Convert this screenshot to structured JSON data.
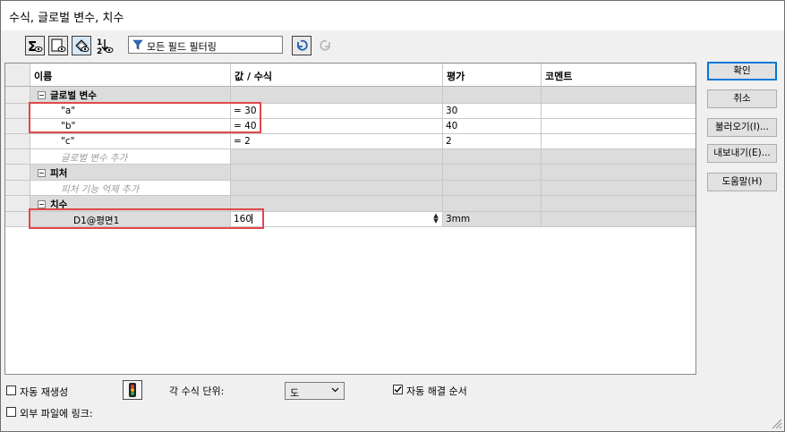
{
  "window": {
    "title": "수식, 글로벌 변수, 치수"
  },
  "toolbar": {
    "filter_text": "모든 필드 필터링",
    "icons": [
      "sigma-eye-icon",
      "display-pane-icon",
      "pressed-settings-icon",
      "sort-12-icon",
      "filter-funnel-icon",
      "undo-icon",
      "redo-icon"
    ]
  },
  "grid": {
    "columns": [
      "이름",
      "값 / 수식",
      "평가",
      "코멘트"
    ],
    "groups": {
      "globals": {
        "label": "글로벌 변수",
        "rows": [
          {
            "name": "\"a\"",
            "value": "= 30",
            "eval": "30",
            "comment": ""
          },
          {
            "name": "\"b\"",
            "value": "= 40",
            "eval": "40",
            "comment": ""
          },
          {
            "name": "\"c\"",
            "value": "= 2",
            "eval": "2",
            "comment": ""
          }
        ],
        "add_placeholder": "글로벌 변수 추가"
      },
      "features": {
        "label": "피처",
        "add_placeholder": "피처 기능 억제 추가"
      },
      "dimensions": {
        "label": "치수",
        "rows": [
          {
            "name": "D1@평면1",
            "value": "160",
            "eval": "3mm",
            "comment": ""
          }
        ]
      }
    }
  },
  "buttons": {
    "ok": "확인",
    "cancel": "취소",
    "import": "불러오기(I)...",
    "export": "내보내기(E)...",
    "help": "도움말(H)"
  },
  "footer": {
    "auto_rebuild_label": "자동 재생성",
    "auto_rebuild_checked": false,
    "link_external_label": "외부 파일에 링크:",
    "link_external_checked": false,
    "angle_unit_label": "각 수식 단위:",
    "angle_unit_value": "도",
    "auto_solve_label": "자동 해결 순서",
    "auto_solve_checked": true
  },
  "colors": {
    "highlight": "#e0474c",
    "group_bg": "#dcdcdc",
    "accent": "#0078d7"
  }
}
